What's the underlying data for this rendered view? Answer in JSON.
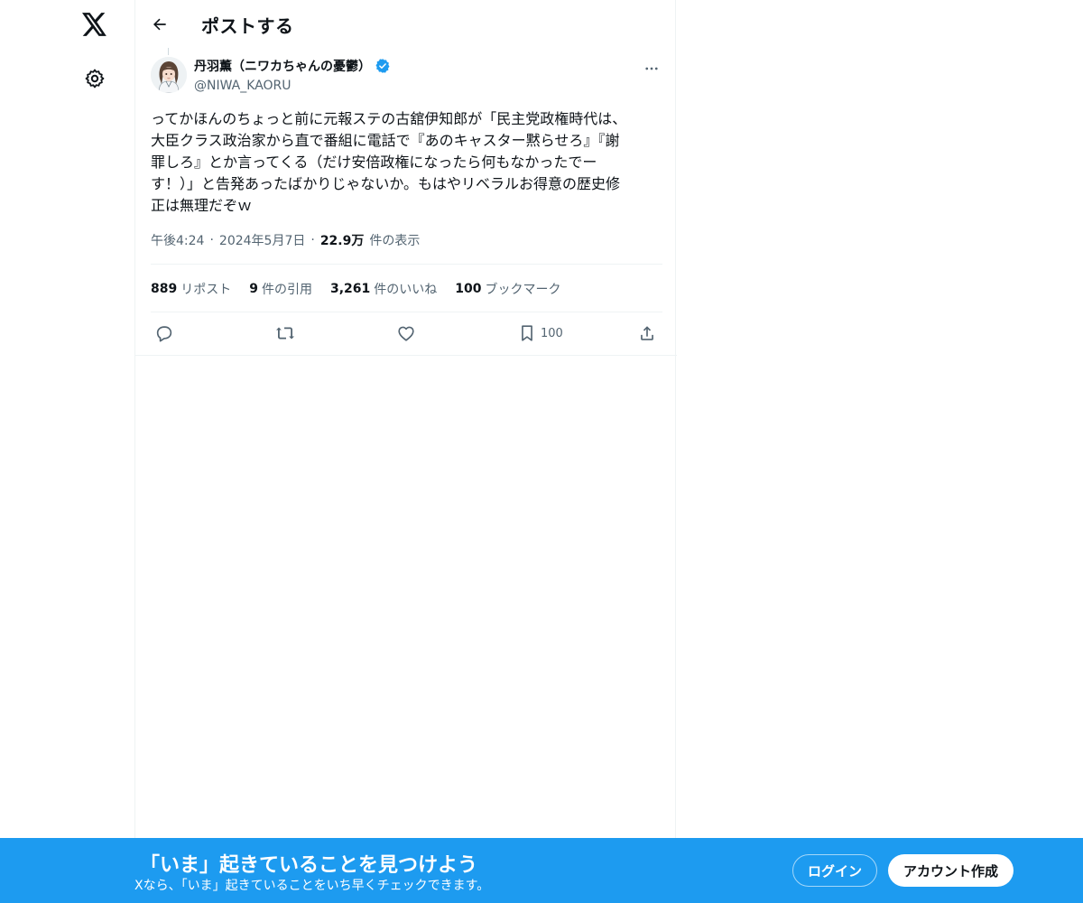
{
  "header": {
    "title": "ポストする"
  },
  "post": {
    "display_name": "丹羽薫（ニワカちゃんの憂鬱）",
    "handle": "@NIWA_KAORU",
    "text": "ってかほんのちょっと前に元報ステの古舘伊知郎が「民主党政権時代は、\n大臣クラス政治家から直で番組に電話で『あのキャスター黙らせろ』『謝\n罪しろ』とか言ってくる（だけ安倍政権になったら何もなかったでー\nす！）」と告発あったばかりじゃないか。もはやリベラルお得意の歴史修\n正は無理だぞｗ",
    "time": "午後4:24",
    "date": "2024年5月7日",
    "views_count": "22.9万",
    "views_label": "件の表示",
    "separator": "·"
  },
  "stats": {
    "reposts_count": "889",
    "reposts_label": "リポスト",
    "quotes_count": "9",
    "quotes_label": "件の引用",
    "likes_count": "3,261",
    "likes_label": "件のいいね",
    "bookmarks_count": "100",
    "bookmarks_label": "ブックマーク"
  },
  "actions": {
    "bookmark_count": "100"
  },
  "icons": {
    "logo": "x-logo-icon",
    "settings": "gear-icon",
    "back": "arrow-left-icon",
    "verified": "verified-badge-icon",
    "more": "more-dots-icon",
    "reply": "reply-icon",
    "repost": "repost-icon",
    "like": "heart-icon",
    "bookmark": "bookmark-icon",
    "share": "share-icon"
  },
  "colors": {
    "accent": "#1d9bf0",
    "text_primary": "#0f1419",
    "text_secondary": "#536471",
    "divider": "#eff3f4"
  },
  "bottom_bar": {
    "title": "「いま」起きていることを見つけよう",
    "subtitle": "Xなら、「いま」起きていることをいち早くチェックできます。",
    "login_label": "ログイン",
    "signup_label": "アカウント作成"
  }
}
